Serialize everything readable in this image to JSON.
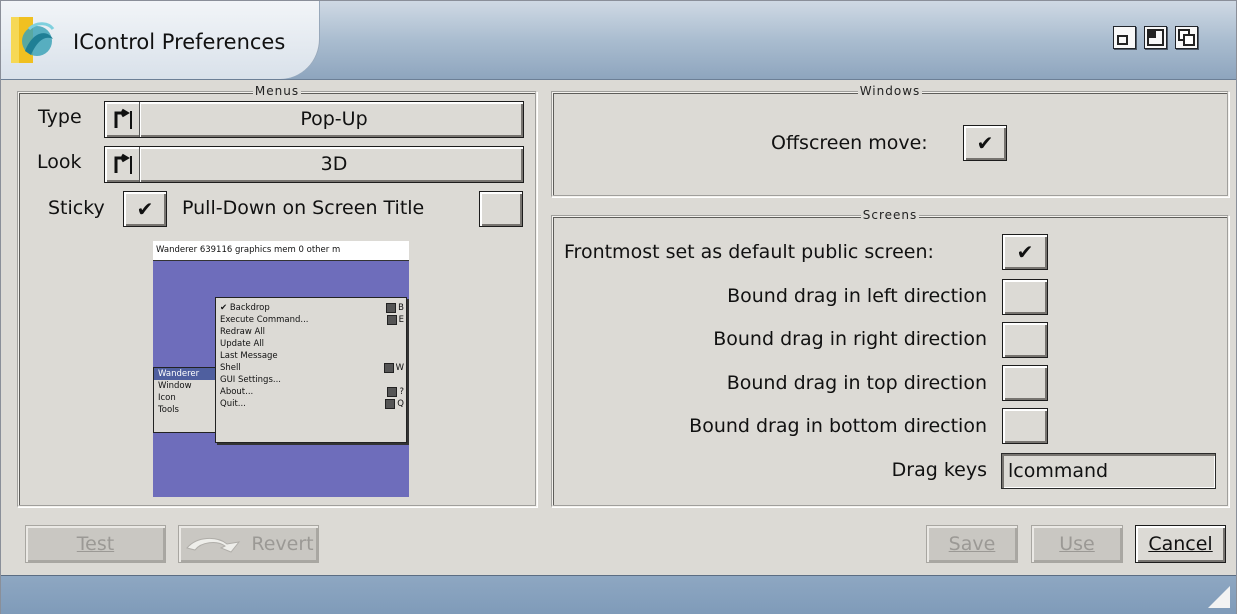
{
  "window": {
    "title": "IControl Preferences"
  },
  "menus": {
    "group_title": "Menus",
    "type_label": "Type",
    "type_value": "Pop-Up",
    "look_label": "Look",
    "look_value": "3D",
    "sticky_label": "Sticky",
    "sticky_checked": "✔",
    "pulldown_label": "Pull-Down on Screen Title",
    "pulldown_checked": ""
  },
  "preview": {
    "bar_text": "Wanderer 639116 graphics mem 0 other m",
    "menubar_items": [
      "Wanderer",
      "Window",
      "Icon",
      "Tools"
    ],
    "menu_items": [
      {
        "label": "✔ Backdrop",
        "key": "B"
      },
      {
        "label": "Execute Command...",
        "key": "E"
      },
      {
        "label": "Redraw All",
        "key": ""
      },
      {
        "label": "Update All",
        "key": ""
      },
      {
        "label": "Last Message",
        "key": ""
      },
      {
        "label": "Shell",
        "key": "W"
      },
      {
        "label": "GUI Settings...",
        "key": ""
      },
      {
        "label": "About...",
        "key": "?"
      },
      {
        "label": "Quit...",
        "key": "Q"
      }
    ]
  },
  "windows": {
    "group_title": "Windows",
    "offscreen_label": "Offscreen move:",
    "offscreen_checked": "✔"
  },
  "screens": {
    "group_title": "Screens",
    "frontmost_label": "Frontmost set as default public screen:",
    "frontmost_checked": "✔",
    "left_label": "Bound drag in left direction",
    "right_label": "Bound drag in right direction",
    "top_label": "Bound drag in top direction",
    "bottom_label": "Bound drag in bottom direction",
    "dragkeys_label": "Drag keys",
    "dragkeys_value": "lcommand"
  },
  "buttons": {
    "test": "Test",
    "revert": "Revert",
    "save": "Save",
    "use": "Use",
    "cancel": "Cancel"
  },
  "colors": {
    "titlebar": "#a9bccf",
    "window_bg": "#dcdad5",
    "preview_bg": "#6e6dbb",
    "statusbar": "#8ea7c2"
  }
}
